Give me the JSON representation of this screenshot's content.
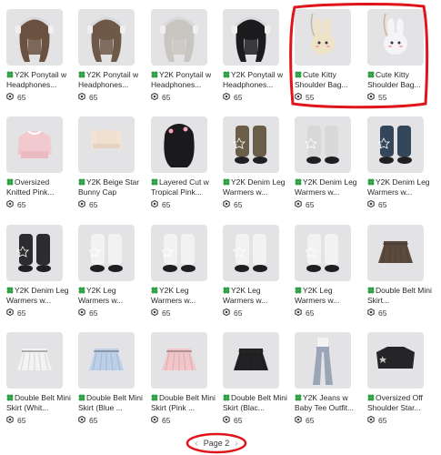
{
  "items": [
    {
      "name": "Y2K Ponytail w Headphones...",
      "price": "65",
      "hair": "#6b5140"
    },
    {
      "name": "Y2K Ponytail w Headphones...",
      "price": "65",
      "hair": "#6e5848"
    },
    {
      "name": "Y2K Ponytail w Headphones...",
      "price": "65",
      "hair": "#c9c6c2"
    },
    {
      "name": "Y2K Ponytail w Headphones...",
      "price": "65",
      "hair": "#1c1c1e"
    },
    {
      "name": "Cute Kitty Shoulder Bag...",
      "price": "55",
      "body": "#efe3c7"
    },
    {
      "name": "Cute Kitty Shoulder Bag...",
      "price": "55",
      "body": "#f6f4f6"
    },
    {
      "name": "Oversized Knitted Pink...",
      "price": "65"
    },
    {
      "name": "Y2K Beige Star Bunny Cap",
      "price": "65"
    },
    {
      "name": "Layered Cut w Tropical Pink...",
      "price": "65"
    },
    {
      "name": "Y2K Denim Leg Warmers w...",
      "price": "65",
      "color": "#6a5e49"
    },
    {
      "name": "Y2K Denim Leg Warmers w...",
      "price": "65",
      "color": "#d8d8d8"
    },
    {
      "name": "Y2K Denim Leg Warmers w...",
      "price": "65",
      "color": "#34465a"
    },
    {
      "name": "Y2K Denim Leg Warmers w...",
      "price": "65",
      "color": "#2c2c2e"
    },
    {
      "name": "Y2K Leg Warmers w...",
      "price": "65",
      "color": "#f2f2f2"
    },
    {
      "name": "Y2K Leg Warmers w...",
      "price": "65",
      "color": "#f2f2f2"
    },
    {
      "name": "Y2K Leg Warmers w...",
      "price": "65",
      "color": "#f2f2f2"
    },
    {
      "name": "Y2K Leg Warmers w...",
      "price": "65",
      "color": "#f2f2f2"
    },
    {
      "name": "Double Belt Mini Skirt...",
      "price": "65",
      "color": "#5b4a3e"
    },
    {
      "name": "Double Belt Mini Skirt (Whit...",
      "price": "65",
      "color": "#f3f3f3"
    },
    {
      "name": "Double Belt Mini Skirt (Blue ...",
      "price": "65",
      "color": "#bcd0ea"
    },
    {
      "name": "Double Belt Mini Skirt (Pink ...",
      "price": "65",
      "color": "#f2c5c8"
    },
    {
      "name": "Double Belt Mini Skirt (Blac...",
      "price": "65",
      "color": "#222224"
    },
    {
      "name": "Y2K Jeans w Baby Tee Outfit...",
      "price": "65",
      "color": "#9aa6b8"
    },
    {
      "name": "Oversized Off Shoulder Star...",
      "price": "65",
      "color": "#252527"
    }
  ],
  "pagination": {
    "label": "Page 2"
  },
  "colors": {
    "highlight": "#e0141b",
    "card_bg": "#e3e3e5",
    "clover": "#2f9e44"
  }
}
